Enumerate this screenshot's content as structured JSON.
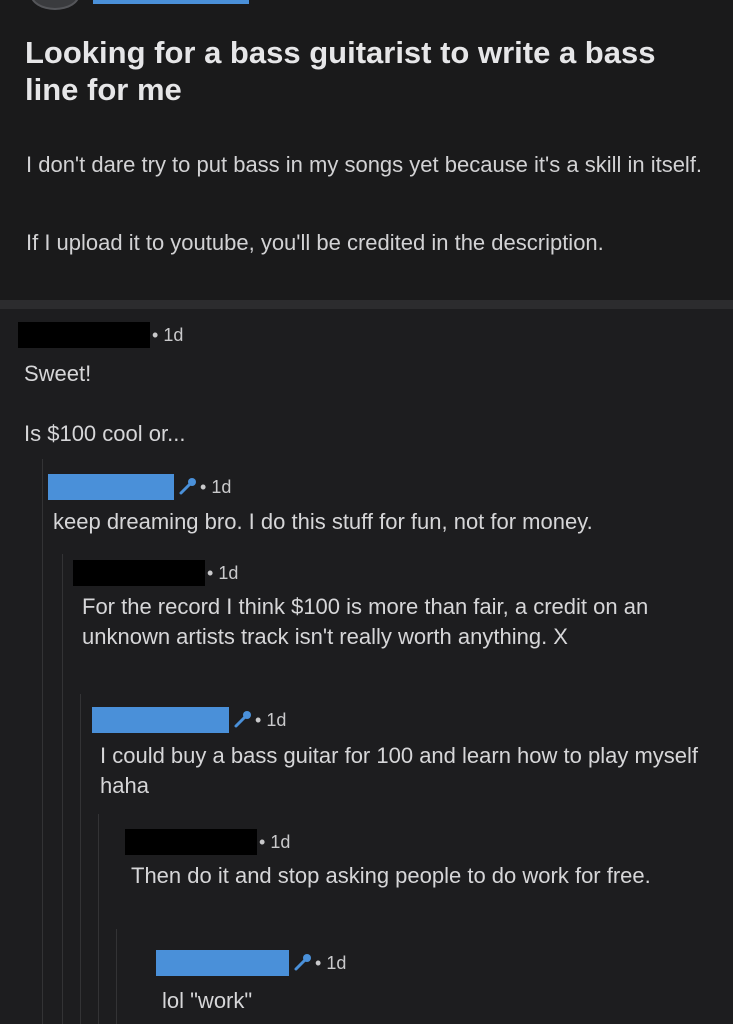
{
  "post": {
    "title": "Looking for a bass guitarist to write a bass line for me",
    "body": [
      "I don't dare try to put bass in my songs yet because it's a skill in itself.",
      "If I upload it to youtube, you'll be credited in the description."
    ]
  },
  "comments": [
    {
      "age": "1d",
      "user_style": "redacted",
      "has_mic_icon": false,
      "body": [
        "Sweet!",
        "Is $100 cool or..."
      ]
    },
    {
      "age": "1d",
      "user_style": "highlighted",
      "has_mic_icon": true,
      "body": [
        "keep dreaming bro. I do this stuff for fun, not for money."
      ]
    },
    {
      "age": "1d",
      "user_style": "redacted",
      "has_mic_icon": false,
      "body": [
        "For the record I think $100 is more than fair, a credit on an unknown artists track isn't really worth anything. X"
      ]
    },
    {
      "age": "1d",
      "user_style": "highlighted",
      "has_mic_icon": true,
      "body": [
        "I could buy a bass guitar for 100 and learn how to play myself haha"
      ]
    },
    {
      "age": "1d",
      "user_style": "redacted",
      "has_mic_icon": false,
      "body": [
        "Then do it and stop asking people to do work for free."
      ]
    },
    {
      "age": "1d",
      "user_style": "highlighted",
      "has_mic_icon": true,
      "body": [
        "lol \"work\""
      ]
    }
  ],
  "colors": {
    "background": "#1b1b1d",
    "username_highlight": "#4a90d9",
    "redaction": "#000000",
    "mic_icon": "#4a90d9"
  },
  "icons": {
    "flair": "microphone-icon"
  }
}
